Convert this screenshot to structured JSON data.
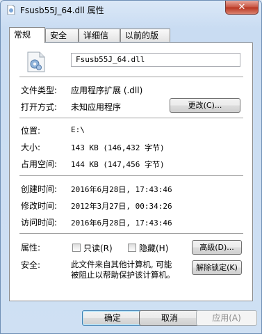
{
  "window": {
    "title": "Fsusb55J_64.dll 属性",
    "close_glyph": "✕"
  },
  "tabs": [
    {
      "label": "常规",
      "active": true
    },
    {
      "label": "安全"
    },
    {
      "label": "详细信息"
    },
    {
      "label": "以前的版本"
    }
  ],
  "general": {
    "file_name": "Fsusb55J_64.dll",
    "file_type_label": "文件类型:",
    "file_type_value": "应用程序扩展 (.dll)",
    "open_with_label": "打开方式:",
    "open_with_value": "未知应用程序",
    "change_button": "更改(C)...",
    "location_label": "位置:",
    "location_value": "E:\\",
    "size_label": "大小:",
    "size_value": "143 KB (146,432 字节)",
    "size_on_disk_label": "占用空间:",
    "size_on_disk_value": "144 KB (147,456 字节)",
    "created_label": "创建时间:",
    "created_value": "2016年6月28日, 17:43:46",
    "modified_label": "修改时间:",
    "modified_value": "2012年3月27日, 00:34:26",
    "accessed_label": "访问时间:",
    "accessed_value": "2016年6月28日, 17:43:46",
    "attributes_label": "属性:",
    "readonly_label": "只读(R)",
    "hidden_label": "隐藏(H)",
    "advanced_button": "高级(D)...",
    "security_label": "安全:",
    "security_text_1": "此文件来自其他计算机, 可能",
    "security_text_2": "被阻止以帮助保护该计算机。",
    "unblock_button": "解除锁定(K)"
  },
  "buttons": {
    "ok": "确定",
    "cancel": "取消",
    "apply": "应用(A)"
  }
}
